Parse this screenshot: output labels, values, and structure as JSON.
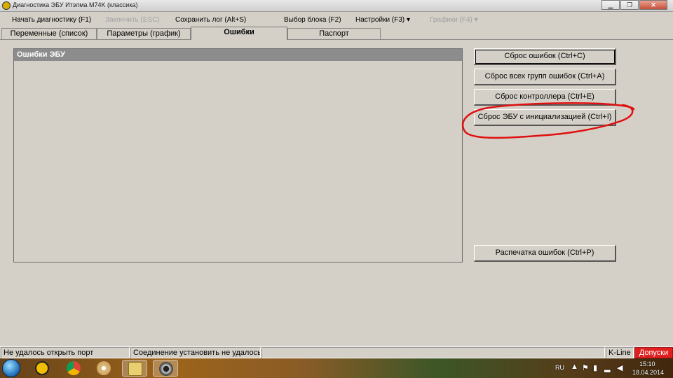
{
  "window": {
    "title": "Диагностика ЭБУ Итэлма M74K (классика)",
    "controls": [
      "▁",
      "❐",
      "✕"
    ]
  },
  "menu": {
    "start_diag": "Начать диагностику (F1)",
    "finish": "Закончить (ESC)",
    "save_log": "Сохранить лог (Alt+S)",
    "select_block": "Выбор блока (F2)",
    "settings": "Настройки (F3)",
    "graphs": "Графики (F4)",
    "dropdown_glyph": "▾"
  },
  "tabs": {
    "variables": "Переменные (список)",
    "params": "Параметры (график)",
    "errors": "Ошибки",
    "passport": "Паспорт"
  },
  "errors_panel": {
    "title": "Ошибки ЭБУ"
  },
  "buttons": {
    "reset_errors": "Сброс ошибок (Ctrl+C)",
    "reset_all_groups": "Сброс всех групп ошибок (Ctrl+A)",
    "reset_controller": "Сброс контроллера (Ctrl+E)",
    "reset_ecu_init": "Сброс ЭБУ с инициализацией (Ctrl+I)",
    "print_errors": "Распечатка ошибок (Ctrl+P)"
  },
  "status": {
    "port": "Не удалось открыть порт",
    "connection": "Соединение установить не удалось",
    "kline": "K-Line",
    "tolerances": "Допуски"
  },
  "taskbar": {
    "lang": "RU",
    "time": "15:10",
    "date": "18.04.2014"
  },
  "colors": {
    "annotation": "#e01010",
    "status_alert": "#e02020"
  }
}
